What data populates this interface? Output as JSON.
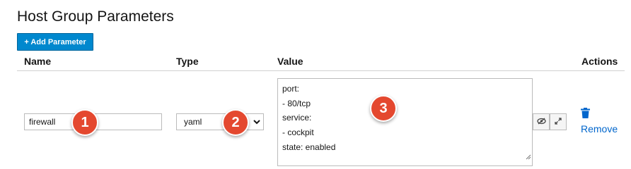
{
  "page": {
    "title": "Host Group Parameters"
  },
  "toolbar": {
    "add_parameter_label": "+ Add Parameter"
  },
  "table": {
    "headers": {
      "name": "Name",
      "type": "Type",
      "value": "Value",
      "actions": "Actions"
    },
    "row": {
      "name_value": "firewall",
      "type_value": "yaml",
      "value_lines": [
        "port:",
        "- 80/tcp",
        "service:",
        "- cockpit",
        "state: enabled"
      ],
      "remove_label": "Remove"
    }
  },
  "annotations": {
    "badge_1": "1",
    "badge_2": "2",
    "badge_3": "3"
  },
  "colors": {
    "primary_button": "#0088ce",
    "link": "#0066cc",
    "badge": "#e4482f",
    "border": "#bbbbbb"
  },
  "icons": {
    "select_chevron": "chevron-down-icon",
    "hide_value": "eye-slash-icon",
    "fullscreen": "expand-icon",
    "delete": "trash-icon"
  }
}
